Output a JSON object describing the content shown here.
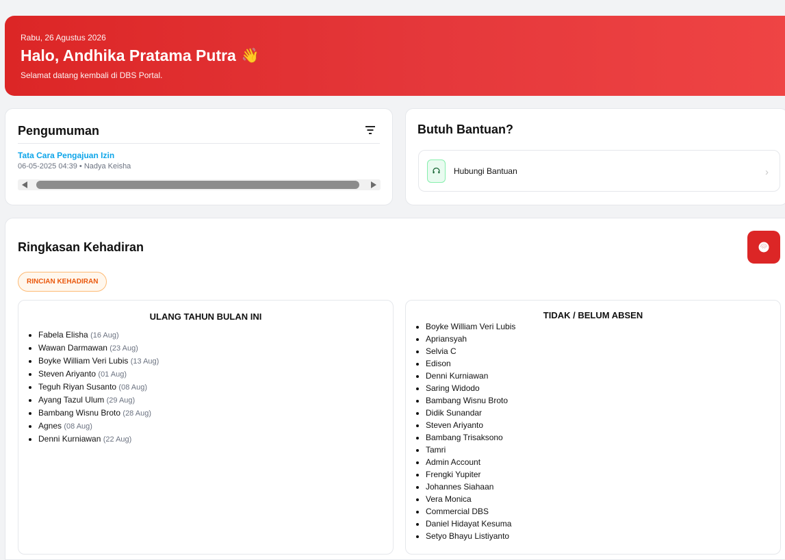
{
  "hero": {
    "date": "Rabu, 26 Agustus 2026",
    "greeting": "Halo, Andhika Pratama Putra",
    "wave": "👋",
    "subtitle": "Selamat datang kembali di DBS Portal."
  },
  "announcements": {
    "title": "Pengumuman",
    "item": {
      "title": "Tata Cara Pengajuan Izin",
      "meta": "06-05-2025 04:39 • Nadya Keisha"
    }
  },
  "help": {
    "title": "Butuh Bantuan?",
    "item_label": "Hubungi Bantuan"
  },
  "attendance": {
    "title": "Ringkasan Kehadiran",
    "details_button": "RINCIAN KEHADIRAN",
    "birthday": {
      "title": "ULANG TAHUN BULAN INI",
      "people": [
        {
          "name": "Fabela Elisha",
          "date": "(16 Aug)"
        },
        {
          "name": "Wawan Darmawan",
          "date": "(23 Aug)"
        },
        {
          "name": "Boyke William Veri Lubis",
          "date": "(13 Aug)"
        },
        {
          "name": "Steven Ariyanto",
          "date": "(01 Aug)"
        },
        {
          "name": "Teguh Riyan Susanto",
          "date": "(08 Aug)"
        },
        {
          "name": "Ayang Tazul Ulum",
          "date": "(29 Aug)"
        },
        {
          "name": "Bambang Wisnu Broto",
          "date": "(28 Aug)"
        },
        {
          "name": "Agnes",
          "date": "(08 Aug)"
        },
        {
          "name": "Denni Kurniawan",
          "date": "(22 Aug)"
        }
      ]
    },
    "absent": {
      "title": "TIDAK / BELUM ABSEN",
      "people": [
        "Boyke William Veri Lubis",
        "Apriansyah",
        "Selvia C",
        "Edison",
        "Denni Kurniawan",
        "Saring Widodo",
        "Bambang Wisnu Broto",
        "Didik Sunandar",
        "Steven Ariyanto",
        "Bambang Trisaksono",
        "Tamri",
        "Admin Account",
        "Frengki Yupiter",
        "Johannes Siahaan",
        "Vera Monica",
        "Commercial DBS",
        "Daniel Hidayat Kesuma",
        "Setyo Bhayu Listiyanto"
      ]
    }
  },
  "colors": {
    "brand_red": "#dc2626",
    "link_blue": "#0ea5e9",
    "pill_orange": "#ea580c",
    "help_green": "#86efac"
  },
  "icons": {
    "filter": "filter-icon",
    "headset": "headset-icon",
    "chevron": "chevron-right-icon",
    "fingerprint": "fingerprint-icon"
  }
}
